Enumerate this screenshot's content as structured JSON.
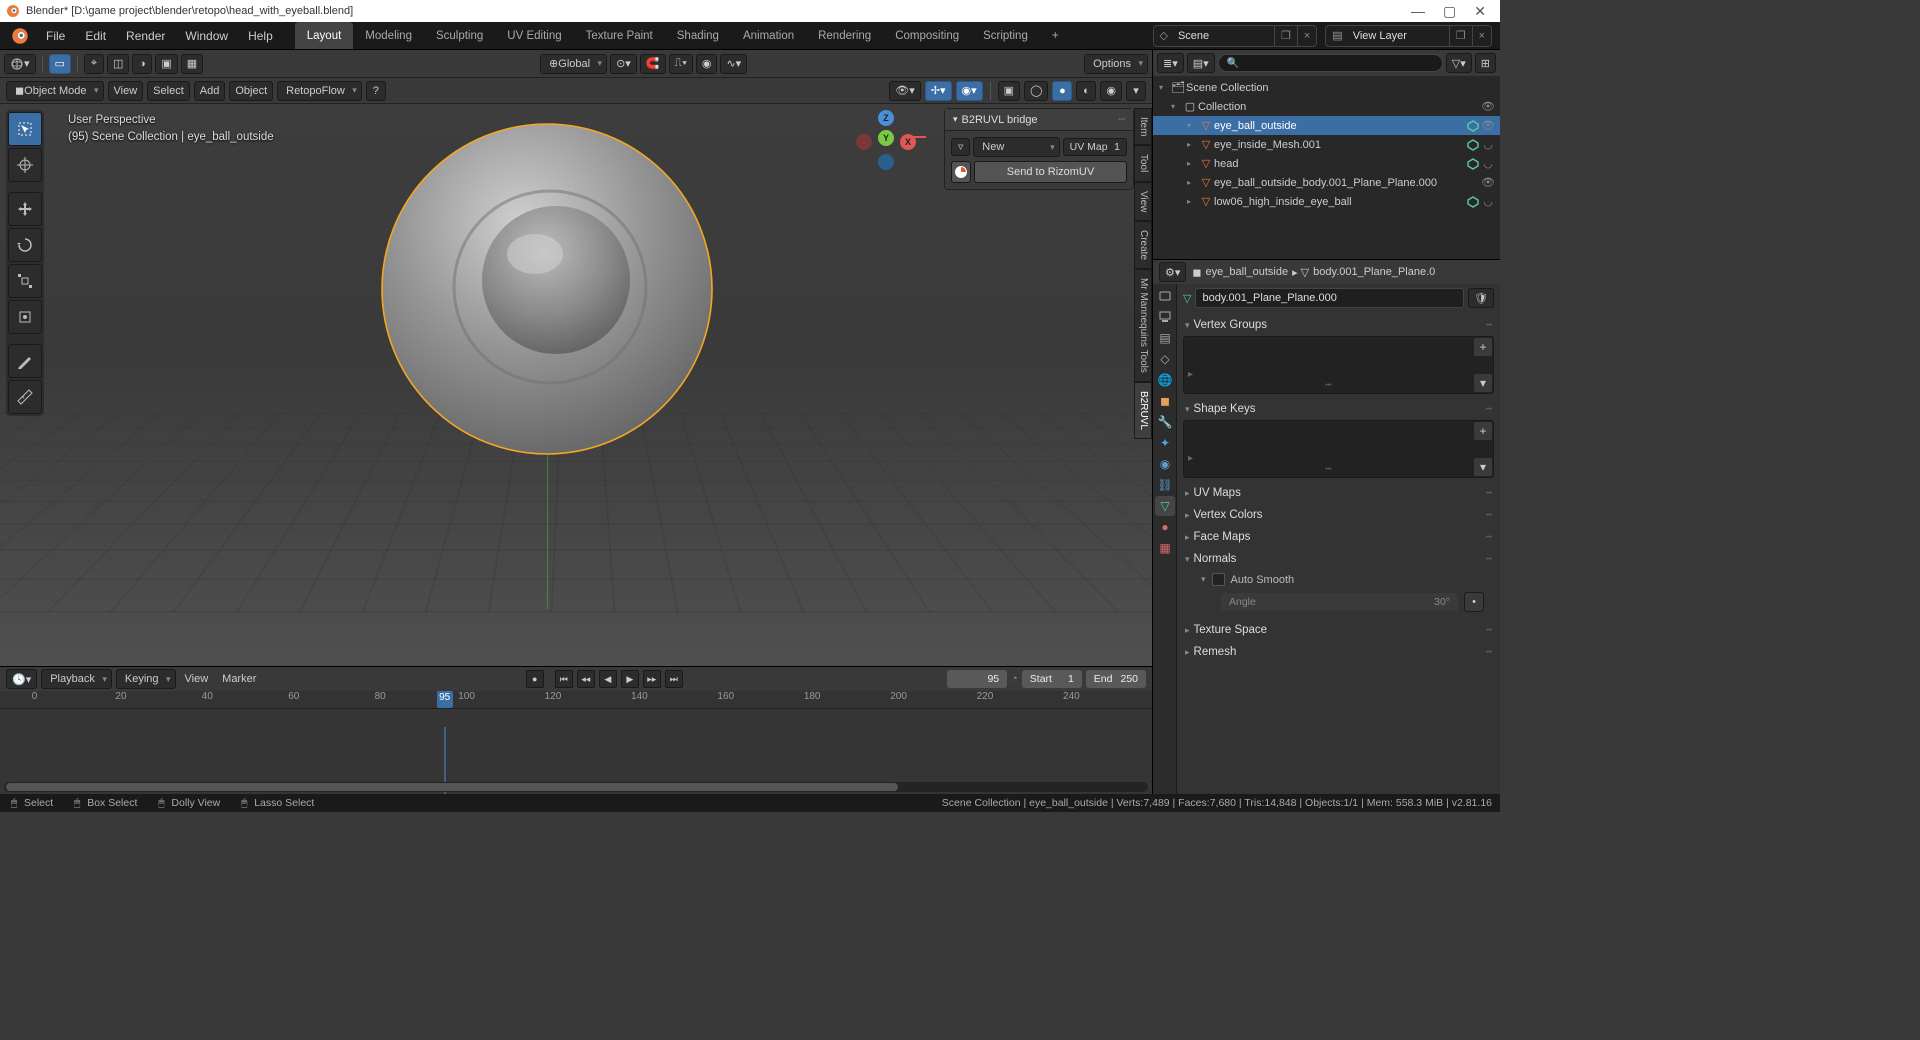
{
  "title": "Blender* [D:\\game project\\blender\\retopo\\head_with_eyeball.blend]",
  "menu": {
    "file": "File",
    "edit": "Edit",
    "render": "Render",
    "window": "Window",
    "help": "Help"
  },
  "ws": [
    "Layout",
    "Modeling",
    "Sculpting",
    "UV Editing",
    "Texture Paint",
    "Shading",
    "Animation",
    "Rendering",
    "Compositing",
    "Scripting"
  ],
  "ws_add": "+",
  "scene_label": "Scene",
  "viewlayer_label": "View Layer",
  "hdr": {
    "mode": "Object Mode",
    "view": "View",
    "select": "Select",
    "add": "Add",
    "object": "Object",
    "retopo": "RetopoFlow",
    "global": "Global",
    "options": "Options"
  },
  "viewport_info": {
    "l1": "User Perspective",
    "l2": "(95) Scene Collection | eye_ball_outside"
  },
  "npanel": {
    "title": "B2RUVL bridge",
    "new": "New",
    "uvmap": "UV Map",
    "uvmap_n": "1",
    "send": "Send to RizomUV",
    "tabs": [
      "Item",
      "Tool",
      "View",
      "Create",
      "Mr Mannequins Tools",
      "B2RUVL"
    ]
  },
  "timeline": {
    "playback": "Playback",
    "keying": "Keying",
    "view": "View",
    "marker": "Marker",
    "cur": "95",
    "start_l": "Start",
    "start_v": "1",
    "end_l": "End",
    "end_v": "250",
    "ticks": [
      {
        "p": 3,
        "l": "0"
      },
      {
        "p": 10.5,
        "l": "20"
      },
      {
        "p": 18,
        "l": "40"
      },
      {
        "p": 25.5,
        "l": "60"
      },
      {
        "p": 33,
        "l": "80"
      },
      {
        "p": 40.5,
        "l": "100"
      },
      {
        "p": 48,
        "l": "120"
      },
      {
        "p": 55.5,
        "l": "140"
      },
      {
        "p": 63,
        "l": "160"
      },
      {
        "p": 70.5,
        "l": "180"
      },
      {
        "p": 78,
        "l": "200"
      },
      {
        "p": 85.5,
        "l": "220"
      },
      {
        "p": 93,
        "l": "240"
      }
    ],
    "playhead_pct": 38.6,
    "playhead_v": "95"
  },
  "outliner": {
    "root": "Scene Collection",
    "rows": [
      {
        "indent": 12,
        "arrow": "▾",
        "icon": "▢",
        "label": "Collection",
        "eye": true
      },
      {
        "indent": 28,
        "arrow": "▾",
        "icon": "▽",
        "label": "eye_ball_outside",
        "sel": true,
        "green": true,
        "eye": true
      },
      {
        "indent": 28,
        "arrow": "▸",
        "icon": "▽",
        "label": "eye_inside_Mesh.001",
        "green": true,
        "dim": true
      },
      {
        "indent": 28,
        "arrow": "▸",
        "icon": "▽",
        "label": "head",
        "green": true,
        "dim": true
      },
      {
        "indent": 28,
        "arrow": "▸",
        "icon": "▽",
        "label": "eye_ball_outside_body.001_Plane_Plane.000",
        "eye": true
      },
      {
        "indent": 28,
        "arrow": "▸",
        "icon": "▽",
        "label": "low06_high_inside_eye_ball",
        "green": true,
        "dim": true
      }
    ]
  },
  "props": {
    "crumb_obj": "eye_ball_outside",
    "crumb_mesh": "body.001_Plane_Plane.0",
    "meshname": "body.001_Plane_Plane.000",
    "panels": {
      "vg": "Vertex Groups",
      "sk": "Shape Keys",
      "uv": "UV Maps",
      "vc": "Vertex Colors",
      "fm": "Face Maps",
      "nm": "Normals",
      "as": "Auto Smooth",
      "angle_l": "Angle",
      "angle_v": "30°",
      "ts": "Texture Space",
      "rm": "Remesh"
    }
  },
  "status": {
    "select": "Select",
    "box": "Box Select",
    "dolly": "Dolly View",
    "lasso": "Lasso Select",
    "stats": "Scene Collection | eye_ball_outside | Verts:7,489 | Faces:7,680 | Tris:14,848 | Objects:1/1 | Mem: 558.3 MiB | v2.81.16"
  }
}
